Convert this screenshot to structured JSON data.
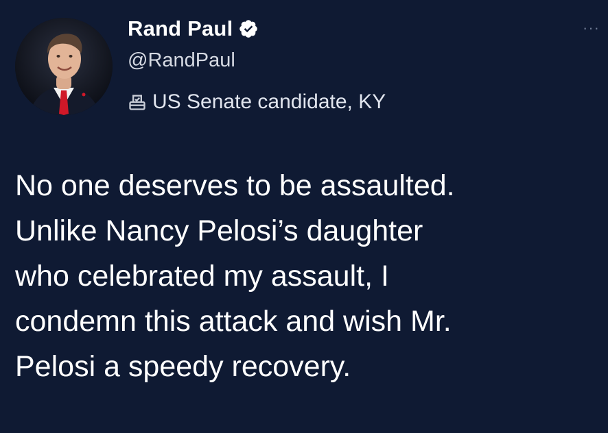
{
  "author": {
    "display_name": "Rand Paul",
    "handle": "@RandPaul",
    "affiliation": "US Senate candidate, KY",
    "verified_icon": "verified-badge-icon",
    "affiliation_icon": "ballot-box-icon"
  },
  "menu": {
    "more_label": "···",
    "icon": "more-options-icon"
  },
  "tweet": {
    "text": "No one deserves to be assaulted.\nUnlike Nancy Pelosi’s daughter\nwho celebrated my assault, I\ncondemn this attack and wish Mr.\nPelosi a speedy recovery."
  },
  "colors": {
    "background": "#0f1a33",
    "text": "#ffffff",
    "secondary_text": "#d6dae3"
  }
}
